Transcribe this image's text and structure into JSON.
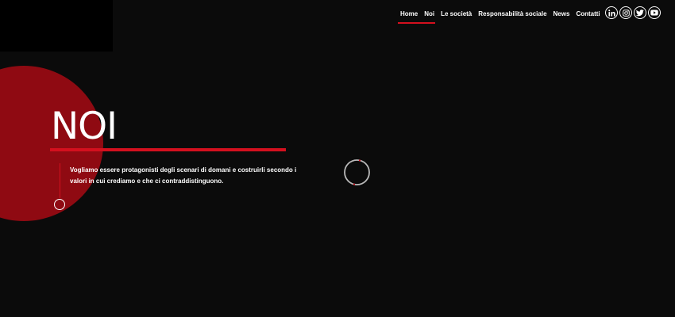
{
  "nav": {
    "items": [
      {
        "label": "Home"
      },
      {
        "label": "Noi"
      },
      {
        "label": "Le società"
      },
      {
        "label": "Responsabilità sociale"
      },
      {
        "label": "News"
      },
      {
        "label": "Contatti"
      }
    ]
  },
  "social": [
    "linkedin-icon",
    "instagram-icon",
    "twitter-icon",
    "youtube-icon"
  ],
  "hero": {
    "title": "NOI",
    "text": "Vogliamo essere protagonisti degli scenari di domani e costruirli secondo i valori in cui crediamo e che ci contraddistinguono."
  },
  "colors": {
    "background": "#0b0b0b",
    "accent": "#d4101e",
    "circle": "#8f0a12"
  }
}
